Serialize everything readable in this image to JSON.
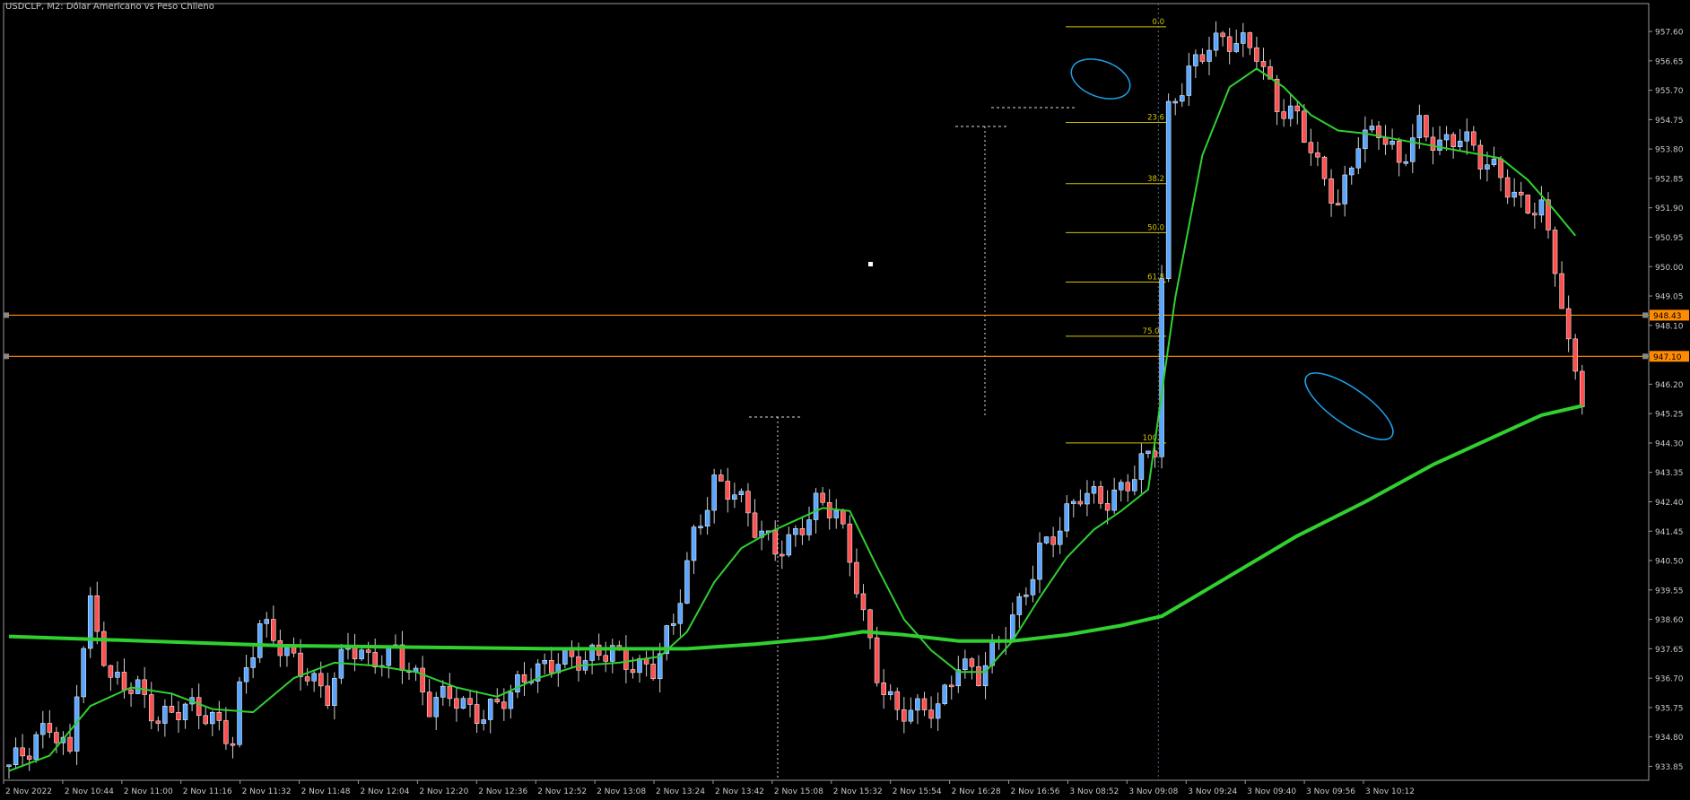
{
  "chart_data": {
    "type": "candlestick",
    "symbol": "USDCLP",
    "timeframe": "M2",
    "title": "USDCLP, M2:  Dólar Americano vs Peso Chileno",
    "ylim": [
      933.4,
      958.5
    ],
    "y_ticks": [
      "957.60",
      "956.65",
      "955.70",
      "954.75",
      "953.80",
      "952.85",
      "951.90",
      "950.95",
      "950.00",
      "949.05",
      "948.10",
      "947.15",
      "946.20",
      "945.25",
      "944.30",
      "943.35",
      "942.40",
      "941.45",
      "940.50",
      "939.55",
      "938.60",
      "937.65",
      "936.70",
      "935.75",
      "934.80",
      "933.85"
    ],
    "x_ticks": [
      "2 Nov 2022",
      "2 Nov 10:44",
      "2 Nov 11:00",
      "2 Nov 11:16",
      "2 Nov 11:32",
      "2 Nov 11:48",
      "2 Nov 12:04",
      "2 Nov 12:20",
      "2 Nov 12:36",
      "2 Nov 12:52",
      "2 Nov 13:08",
      "2 Nov 13:24",
      "2 Nov 13:42",
      "2 Nov 15:08",
      "2 Nov 15:32",
      "2 Nov 15:54",
      "2 Nov 16:28",
      "2 Nov 16:56",
      "3 Nov 08:52",
      "3 Nov 09:08",
      "3 Nov 09:24",
      "3 Nov 09:40",
      "3 Nov 09:56",
      "3 Nov 10:12"
    ],
    "bar_count": 236,
    "close_path": [
      [
        0,
        933.9
      ],
      [
        3,
        934.2
      ],
      [
        6,
        935.2
      ],
      [
        9,
        934.4
      ],
      [
        10,
        936.6
      ],
      [
        12,
        939.0
      ],
      [
        15,
        936.4
      ],
      [
        19,
        936.5
      ],
      [
        22,
        935.5
      ],
      [
        26,
        935.6
      ],
      [
        30,
        935.4
      ],
      [
        33,
        934.9
      ],
      [
        34,
        936.4
      ],
      [
        37,
        938.3
      ],
      [
        40,
        937.6
      ],
      [
        44,
        937.0
      ],
      [
        47,
        936.2
      ],
      [
        50,
        937.6
      ],
      [
        53,
        937.2
      ],
      [
        57,
        937.8
      ],
      [
        60,
        936.6
      ],
      [
        62,
        935.6
      ],
      [
        65,
        936.2
      ],
      [
        70,
        935.6
      ],
      [
        74,
        936.0
      ],
      [
        77,
        936.9
      ],
      [
        81,
        937.5
      ],
      [
        85,
        937.1
      ],
      [
        89,
        937.6
      ],
      [
        92,
        937.3
      ],
      [
        95,
        937.0
      ],
      [
        98,
        938.3
      ],
      [
        101,
        941.3
      ],
      [
        104,
        943.2
      ],
      [
        107,
        942.7
      ],
      [
        110,
        941.4
      ],
      [
        113,
        940.9
      ],
      [
        116,
        941.5
      ],
      [
        119,
        942.3
      ],
      [
        122,
        941.9
      ],
      [
        125,
        939.8
      ],
      [
        128,
        937.0
      ],
      [
        131,
        935.5
      ],
      [
        134,
        935.5
      ],
      [
        137,
        935.8
      ],
      [
        140,
        937.4
      ],
      [
        143,
        936.7
      ],
      [
        146,
        937.7
      ],
      [
        149,
        939.1
      ],
      [
        152,
        941.0
      ],
      [
        155,
        941.5
      ],
      [
        158,
        942.5
      ],
      [
        162,
        942.6
      ],
      [
        166,
        943.3
      ],
      [
        169,
        944.0
      ],
      [
        171,
        954.9
      ],
      [
        174,
        956.5
      ],
      [
        177,
        957.3
      ],
      [
        180,
        957.1
      ],
      [
        184,
        957.0
      ],
      [
        187,
        955.4
      ],
      [
        190,
        954.8
      ],
      [
        193,
        953.0
      ],
      [
        196,
        952.0
      ],
      [
        199,
        954.3
      ],
      [
        202,
        954.4
      ],
      [
        205,
        953.1
      ],
      [
        208,
        954.6
      ],
      [
        211,
        954.1
      ],
      [
        214,
        954.2
      ],
      [
        217,
        953.3
      ],
      [
        220,
        953.0
      ],
      [
        223,
        952.2
      ],
      [
        226,
        951.8
      ],
      [
        228,
        949.9
      ],
      [
        230,
        947.2
      ],
      [
        231,
        946.6
      ],
      [
        232,
        945.9
      ]
    ],
    "ma_fast": [
      [
        0,
        933.7
      ],
      [
        6,
        934.2
      ],
      [
        12,
        935.8
      ],
      [
        18,
        936.4
      ],
      [
        24,
        936.2
      ],
      [
        30,
        935.7
      ],
      [
        36,
        935.6
      ],
      [
        42,
        936.7
      ],
      [
        48,
        937.2
      ],
      [
        54,
        937.1
      ],
      [
        60,
        936.9
      ],
      [
        66,
        936.4
      ],
      [
        72,
        936.1
      ],
      [
        78,
        936.7
      ],
      [
        84,
        937.1
      ],
      [
        90,
        937.2
      ],
      [
        96,
        937.4
      ],
      [
        100,
        938.2
      ],
      [
        104,
        939.8
      ],
      [
        108,
        940.9
      ],
      [
        112,
        941.4
      ],
      [
        116,
        941.8
      ],
      [
        120,
        942.2
      ],
      [
        124,
        942.1
      ],
      [
        128,
        940.3
      ],
      [
        132,
        938.6
      ],
      [
        136,
        937.6
      ],
      [
        140,
        936.9
      ],
      [
        144,
        936.9
      ],
      [
        148,
        937.9
      ],
      [
        152,
        939.3
      ],
      [
        156,
        940.6
      ],
      [
        160,
        941.5
      ],
      [
        164,
        942.1
      ],
      [
        168,
        942.8
      ],
      [
        172,
        949.0
      ],
      [
        176,
        953.6
      ],
      [
        180,
        955.8
      ],
      [
        184,
        956.4
      ],
      [
        188,
        955.8
      ],
      [
        192,
        954.9
      ],
      [
        196,
        954.4
      ],
      [
        200,
        954.3
      ],
      [
        205,
        954.1
      ],
      [
        210,
        953.9
      ],
      [
        215,
        953.7
      ],
      [
        220,
        953.5
      ],
      [
        224,
        952.8
      ],
      [
        228,
        951.8
      ],
      [
        231,
        951.0
      ]
    ],
    "ma_slow": [
      [
        0,
        938.05
      ],
      [
        20,
        937.9
      ],
      [
        40,
        937.75
      ],
      [
        60,
        937.7
      ],
      [
        80,
        937.65
      ],
      [
        100,
        937.65
      ],
      [
        110,
        937.8
      ],
      [
        120,
        938.0
      ],
      [
        126,
        938.2
      ],
      [
        132,
        938.1
      ],
      [
        140,
        937.9
      ],
      [
        148,
        937.9
      ],
      [
        156,
        938.1
      ],
      [
        164,
        938.4
      ],
      [
        170,
        938.7
      ],
      [
        180,
        940.0
      ],
      [
        190,
        941.3
      ],
      [
        200,
        942.4
      ],
      [
        210,
        943.6
      ],
      [
        220,
        944.6
      ],
      [
        226,
        945.2
      ],
      [
        232,
        945.5
      ]
    ],
    "horizontal_levels": [
      {
        "price": 948.43,
        "label": "948.43"
      },
      {
        "price": 947.1,
        "label": "947.10"
      }
    ],
    "fibonacci": {
      "levels": [
        {
          "label": "0.0",
          "price": 957.75
        },
        {
          "label": "23.6",
          "price": 954.66
        },
        {
          "label": "38.2",
          "price": 952.68
        },
        {
          "label": "50.0",
          "price": 951.1
        },
        {
          "label": "61.8",
          "price": 949.5
        },
        {
          "label": "75.00",
          "price": 947.75
        },
        {
          "label": "100.0",
          "price": 944.3
        }
      ]
    },
    "grid": false,
    "legend": "none"
  },
  "colors": {
    "background": "#000000",
    "axis": "#9a9a9a",
    "bull": "#58a6ff",
    "bear": "#ff5050",
    "ma": "#30d030",
    "level": "#ff8c00",
    "level_label_bg": "#ff8c00",
    "fib": "#d4c400",
    "ellipse": "#1ea0e8",
    "separator": "#4a6a8a",
    "text": "#c8c8c8"
  }
}
